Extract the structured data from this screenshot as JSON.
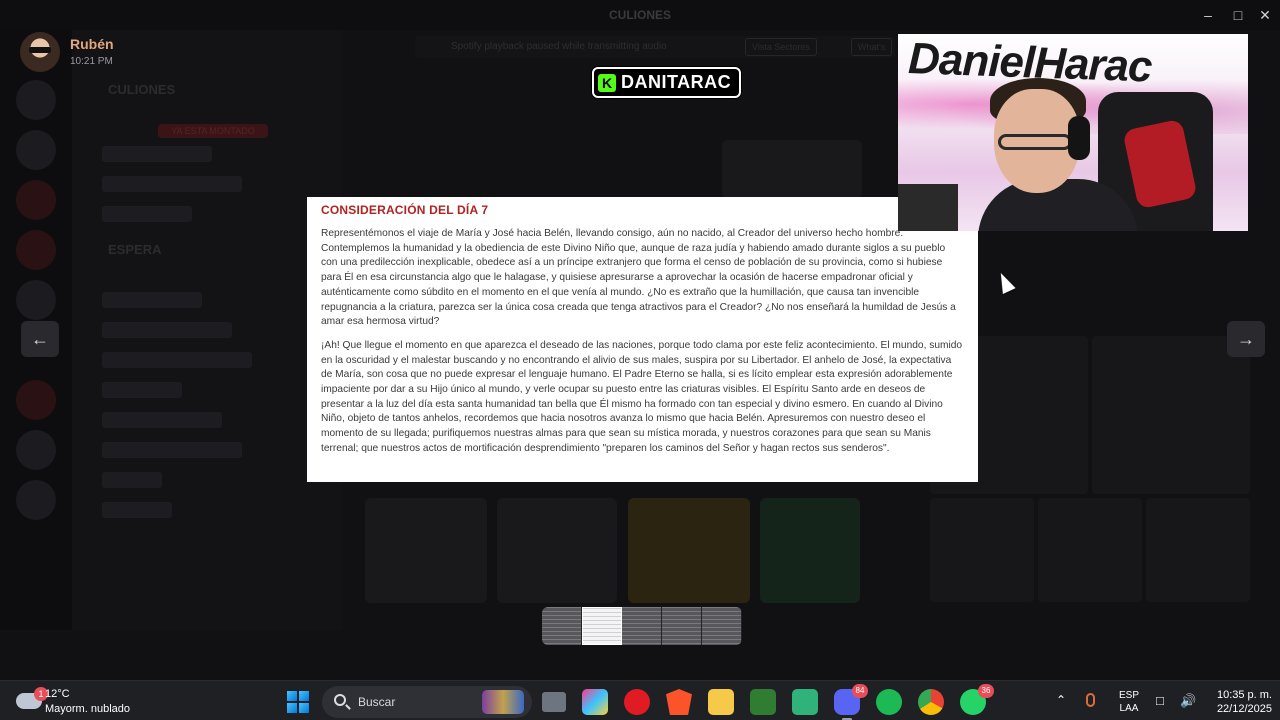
{
  "user": {
    "name": "Rubén",
    "time": "10:21 PM"
  },
  "background": {
    "window_title": "CULIONES",
    "server_name": "CULIONES",
    "section_espera": "ESPERA",
    "tag_label": "YA ESTA MONTADO",
    "spotify_notice": "Spotify playback paused while transmitting audio",
    "spotify_button": "Vista Sectores",
    "spotify_button2": "What's"
  },
  "stream": {
    "platform_icon": "K",
    "channel": "DANITARAC"
  },
  "document": {
    "title": "CONSIDERACIÓN DEL DÍA 7",
    "paragraph1": "Representémonos el viaje de María y José hacia Belén, llevando consigo, aún no nacido, al Creador del universo hecho hombre. Contemplemos la humanidad y la obediencia de este Divino Niño que, aunque de raza judía y habiendo amado durante siglos a su pueblo con una predilección inexplicable, obedece así a un príncipe extranjero que forma el censo de población de su provincia, como si hubiese para Él en esa circunstancia algo que le halagase, y quisiese apresurarse a aprovechar la ocasión de hacerse empadronar oficial y auténticamente como súbdito en el momento en el que venía al mundo. ¿No es extraño que la humillación, que causa tan invencible repugnancia a la criatura, parezca ser la única cosa creada que tenga atractivos para el Creador? ¿No nos enseñará la humildad de Jesús a amar esa hermosa virtud?",
    "paragraph2": "¡Ah! Que llegue el momento en que aparezca el deseado de las naciones, porque todo clama por este feliz acontecimiento. El mundo, sumido en la oscuridad y el malestar buscando y no encontrando el alivio de sus males, suspira por su Libertador. El anhelo de José, la expectativa de María, son cosa que no puede expresar el lenguaje humano. El Padre Eterno se halla, si es lícito emplear esta expresión adorablemente impaciente por dar a su Hijo único al mundo, y verle ocupar su puesto entre las criaturas visibles. El Espíritu Santo arde en deseos de presentar a la luz del día esta santa humanidad tan bella que Él mismo ha formado con tan especial y divino esmero. En cuando al Divino Niño, objeto de tantos anhelos, recordemos que hacia nosotros avanza lo mismo que hacia Belén. Apresuremos con nuestro deseo el momento de su llegada; purifiquemos nuestras almas para que sean su mística morada, y nuestros corazones para que sean su Manis terrenal; que nuestros actos de mortificación desprendimiento \"preparen los caminos del Señor y hagan rectos sus senderos\"."
  },
  "webcam": {
    "graffiti_text": "DanielHarac"
  },
  "carousel": {
    "prev_icon": "←",
    "next_icon": "→",
    "thumbnail_count": 5,
    "active_index": 1
  },
  "taskbar": {
    "weather_temp": "12°C",
    "weather_desc": "Mayorm. nublado",
    "weather_badge": "1",
    "search_label": "Buscar",
    "discord_badge": "84",
    "whatsapp_badge": "36",
    "lang_line1": "ESP",
    "lang_line2": "LAA",
    "clock_time": "10:35 p. m.",
    "clock_date": "22/12/2025",
    "colors": {
      "opera": "#e01b24",
      "brave": "#fb542b",
      "files": "#f7c948",
      "discord": "#5865f2",
      "spotify": "#1db954",
      "whatsapp": "#25d366"
    }
  }
}
